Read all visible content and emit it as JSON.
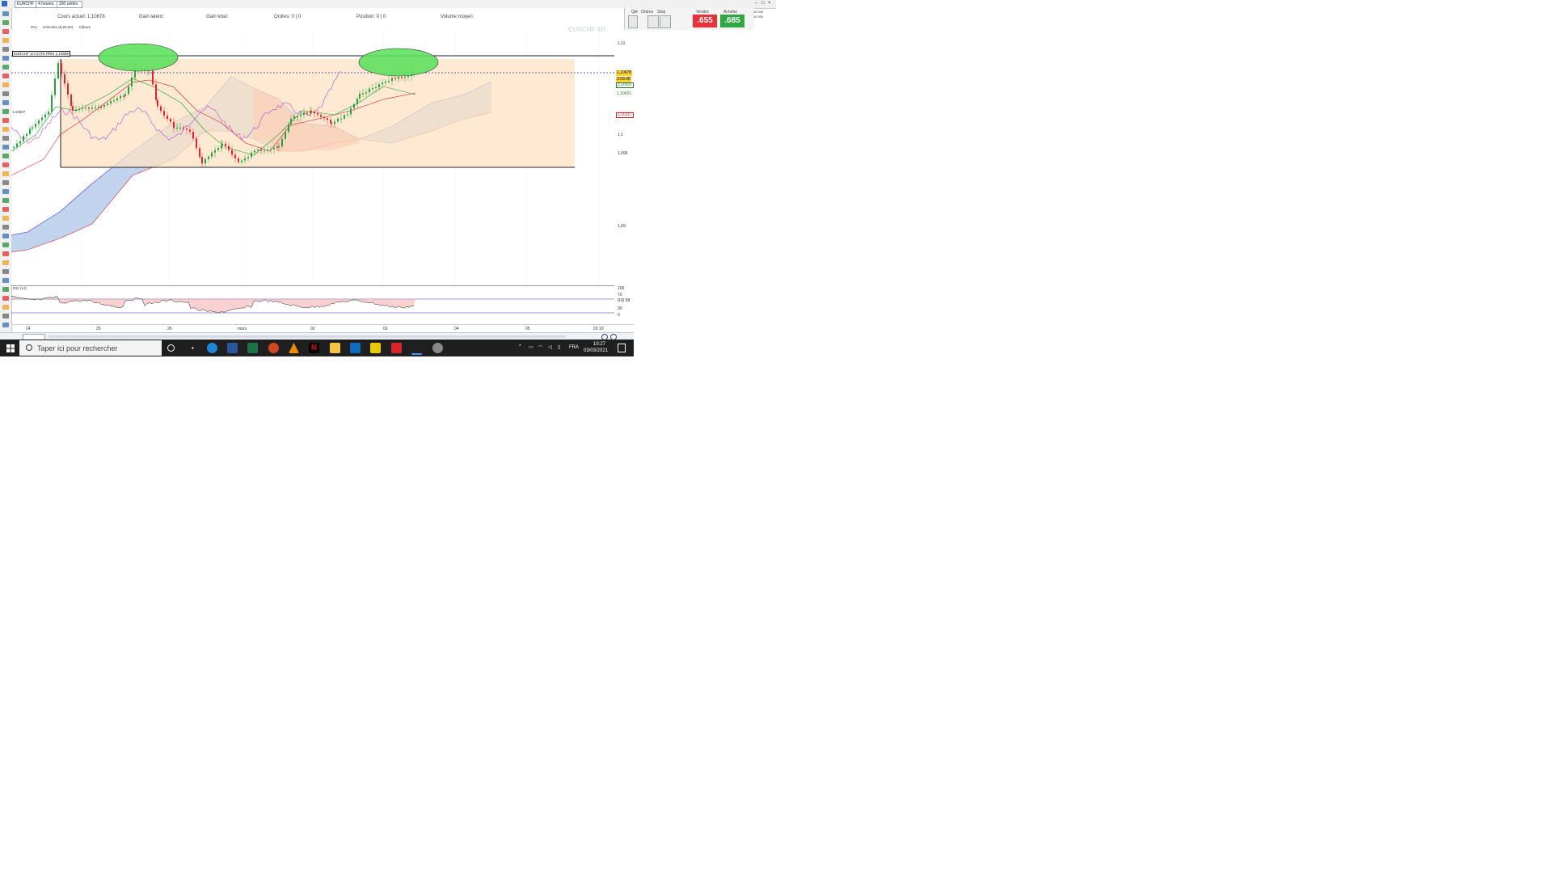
{
  "toolbar": {
    "symbol": "EURCHF",
    "timeframe": "4 heures",
    "units": "200 unités"
  },
  "infobar": {
    "items": [
      "Cours actuel: 1,10678",
      "Gain latent:",
      "Gain total:",
      "Ordres: 0 | 0",
      "Position: 0 | 0",
      "Volume moyen:"
    ]
  },
  "trade_panel": {
    "qty_label": "Qté",
    "ordres_label": "Ordres",
    "stop_label": "Stop",
    "vendre_label": "Vendre",
    "acheter_label": "Acheter",
    "sell_price": ".655",
    "buy_price": ".685"
  },
  "account": {
    "line1": "10 000",
    "line2": "10 000"
  },
  "chart": {
    "watermark": "EURCHF  4H",
    "legend_items": [
      "Prix",
      "Ichimoku (9,26,52)",
      "Clôture"
    ],
    "rect_label": "EURCHF  1H  CATS  PRIX 1,10685",
    "left_label": "1,10607",
    "y_ticks": [
      "1,11",
      "1,1",
      "1,095",
      "1,09"
    ],
    "tags": {
      "current": "1,10678",
      "current_sub": "3:09:08",
      "level2": "1,10537",
      "level3": "1,10421",
      "level4": "1,10117"
    }
  },
  "rsi": {
    "label": "RSI (14)",
    "sub_label": "RSI (14)",
    "ticks": [
      "100",
      "70",
      "RSI 58",
      "30",
      "0"
    ]
  },
  "xaxis": {
    "labels": [
      "24",
      "25",
      "26",
      "mars",
      "02",
      "03",
      "04",
      "05",
      "03 10"
    ]
  },
  "taskbar": {
    "search_placeholder": "Taper ici pour rechercher",
    "language": "FRA",
    "time": "10:27",
    "date": "03/03/2021"
  },
  "colors": {
    "bull": "#26a33a",
    "bear": "#e0242f",
    "zone": "#fde3c4",
    "ellipse": "#5ee05e",
    "cloud_blue": "#aec4e8",
    "cloud_red": "#f6a5a0",
    "chikou": "#b34fd0",
    "resistance": "#3333cc"
  }
}
